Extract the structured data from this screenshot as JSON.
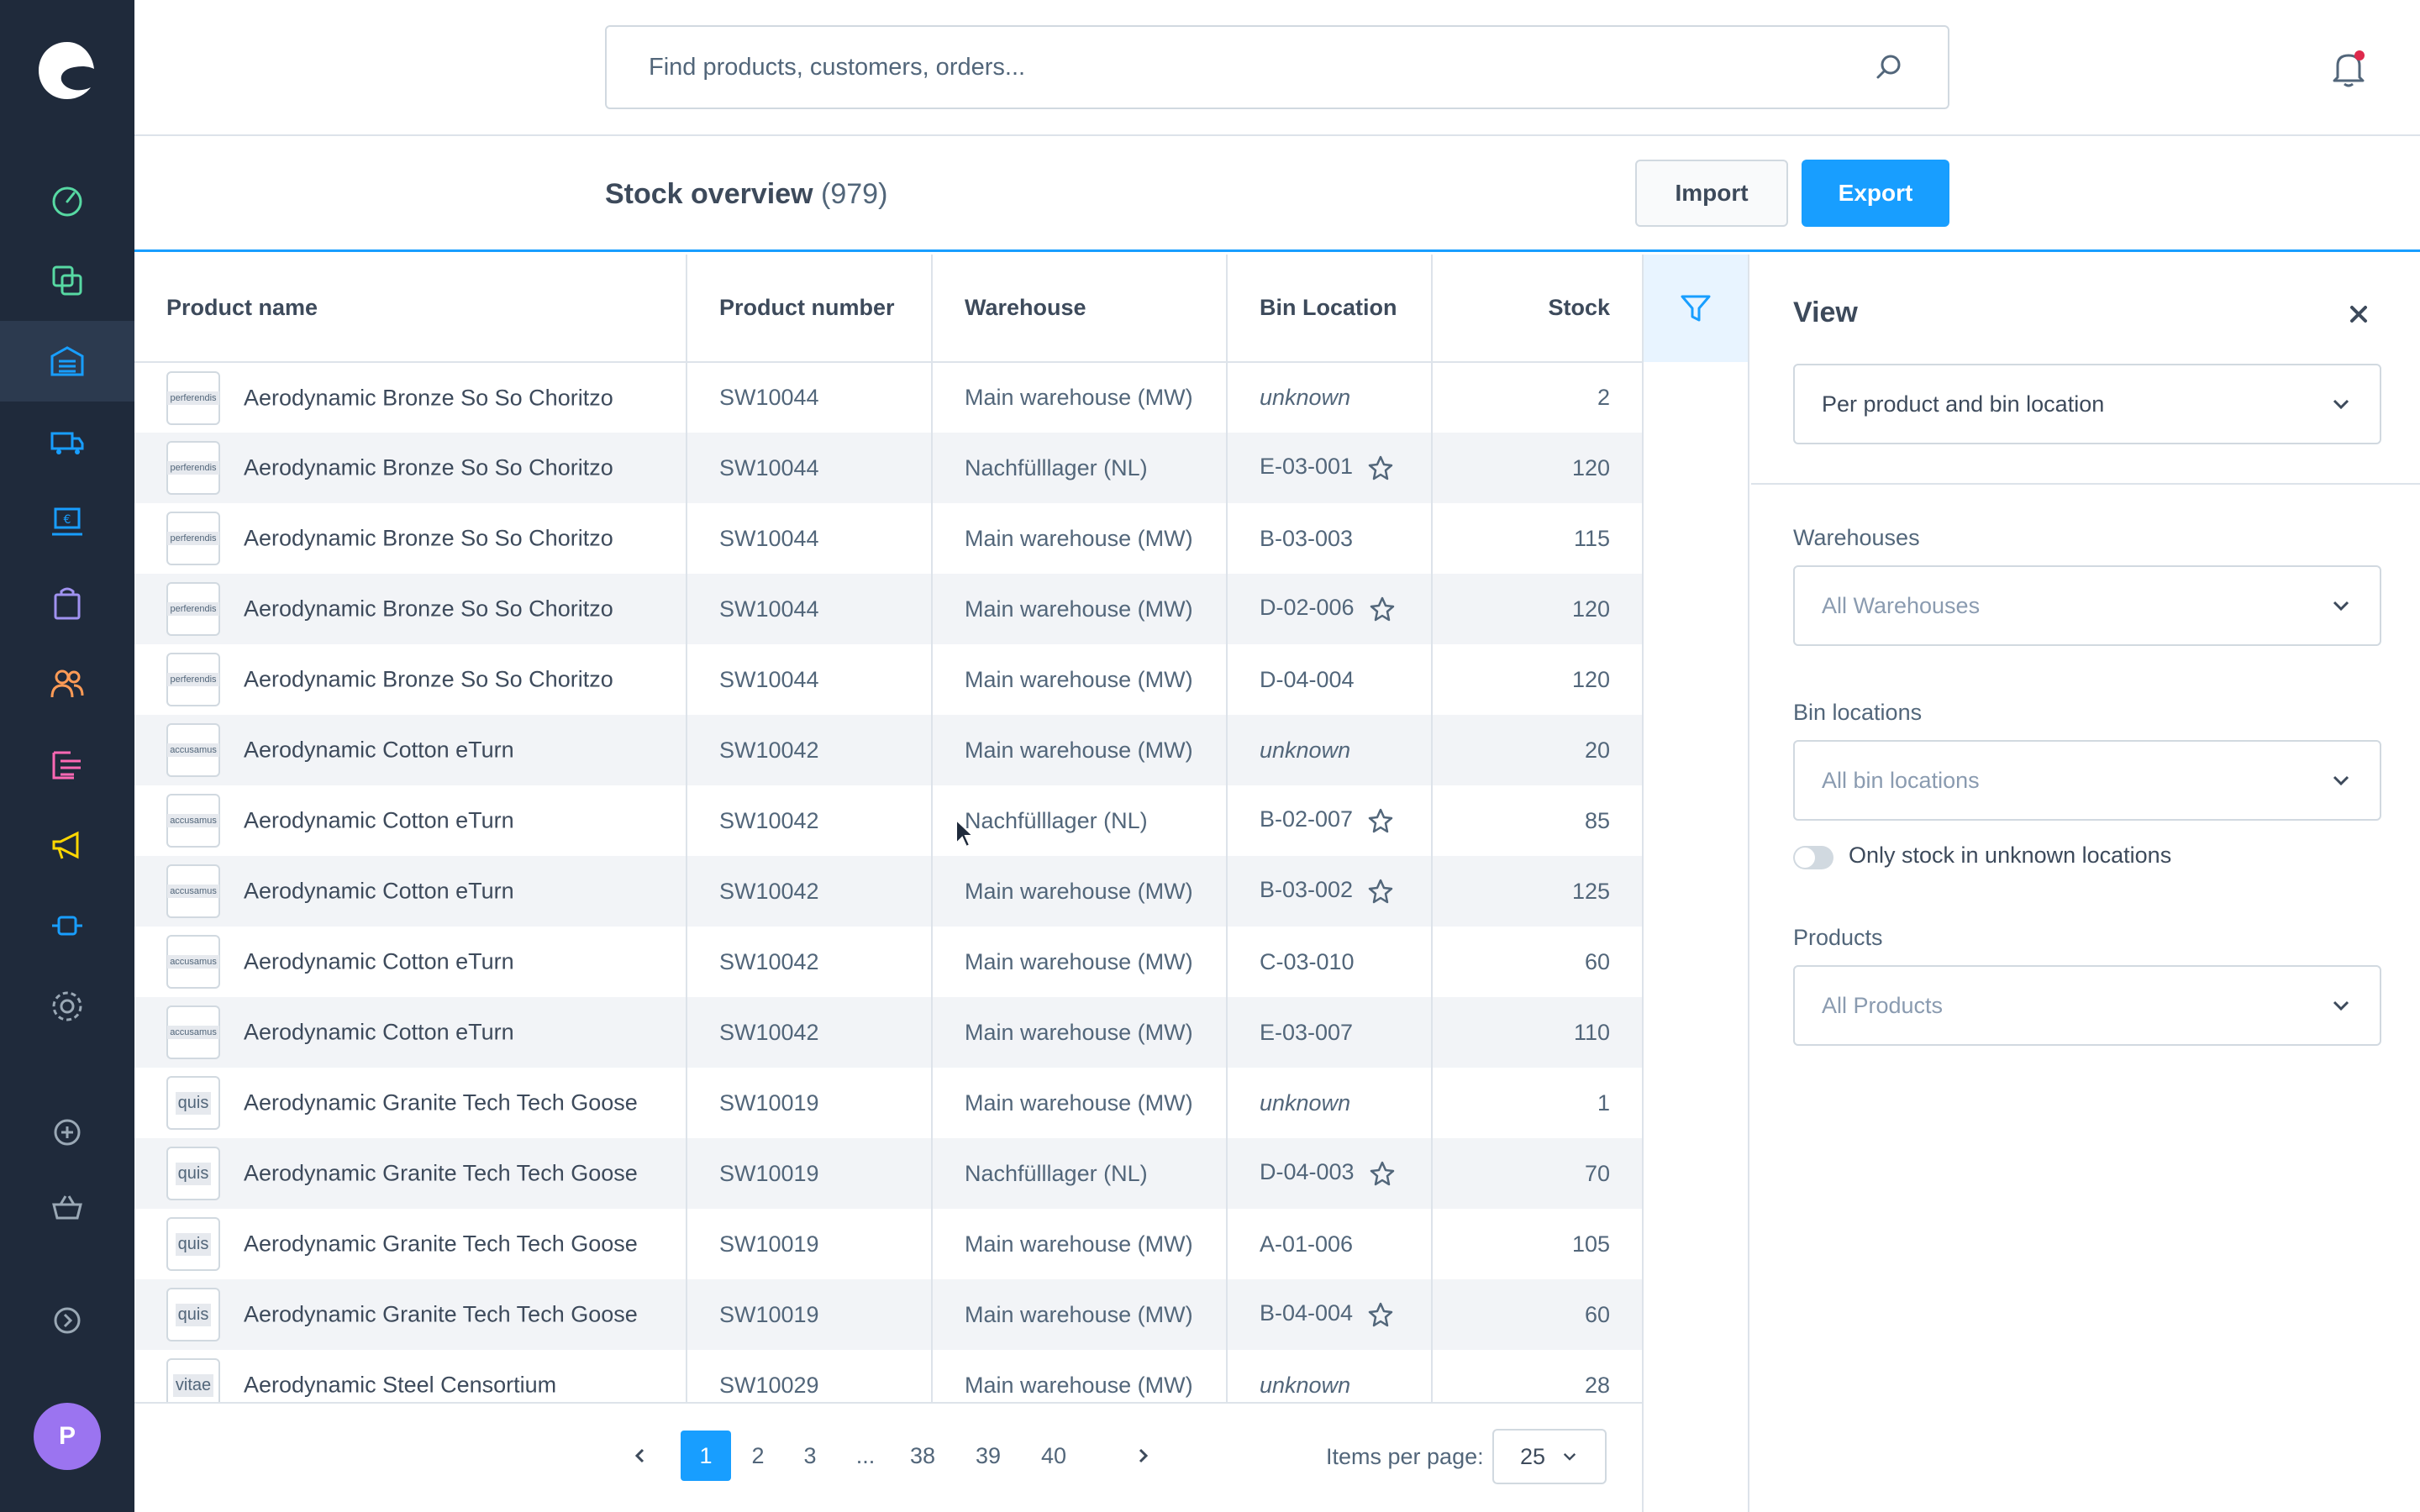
{
  "sidebar": {
    "items": [
      {
        "icon": "dashboard-icon",
        "color": "#57d9a3"
      },
      {
        "icon": "catalog-icon",
        "color": "#57d9a3"
      },
      {
        "icon": "warehouse-icon",
        "color": "#189eff"
      },
      {
        "icon": "shipping-icon",
        "color": "#189eff"
      },
      {
        "icon": "pos-icon",
        "color": "#189eff"
      },
      {
        "icon": "orders-icon",
        "color": "#a092f0"
      },
      {
        "icon": "customers-icon",
        "color": "#ff9b56"
      },
      {
        "icon": "content-icon",
        "color": "#ff68b4"
      },
      {
        "icon": "marketing-icon",
        "color": "#ffd700"
      },
      {
        "icon": "extensions-icon",
        "color": "#189eff"
      },
      {
        "icon": "settings-icon",
        "color": "#9aa8b5"
      },
      {
        "icon": "add-icon",
        "color": "#9aa8b5"
      },
      {
        "icon": "basket-icon",
        "color": "#9aa8b5"
      },
      {
        "icon": "expand-icon",
        "color": "#9aa8b5"
      }
    ],
    "avatar_initial": "P"
  },
  "search": {
    "placeholder": "Find products, customers, orders..."
  },
  "header": {
    "title": "Stock overview",
    "count": "(979)",
    "import_label": "Import",
    "export_label": "Export"
  },
  "table": {
    "columns": [
      "Product name",
      "Product number",
      "Warehouse",
      "Bin Location",
      "Stock"
    ],
    "rows": [
      {
        "thumb": "perferendis",
        "name": "Aerodynamic Bronze So So Choritzo",
        "number": "SW10044",
        "warehouse": "Main warehouse (MW)",
        "bin": "unknown",
        "unknown": true,
        "star": false,
        "stock": "2"
      },
      {
        "thumb": "perferendis",
        "name": "Aerodynamic Bronze So So Choritzo",
        "number": "SW10044",
        "warehouse": "Nachfülllager (NL)",
        "bin": "E-03-001",
        "unknown": false,
        "star": true,
        "stock": "120"
      },
      {
        "thumb": "perferendis",
        "name": "Aerodynamic Bronze So So Choritzo",
        "number": "SW10044",
        "warehouse": "Main warehouse (MW)",
        "bin": "B-03-003",
        "unknown": false,
        "star": false,
        "stock": "115"
      },
      {
        "thumb": "perferendis",
        "name": "Aerodynamic Bronze So So Choritzo",
        "number": "SW10044",
        "warehouse": "Main warehouse (MW)",
        "bin": "D-02-006",
        "unknown": false,
        "star": true,
        "stock": "120"
      },
      {
        "thumb": "perferendis",
        "name": "Aerodynamic Bronze So So Choritzo",
        "number": "SW10044",
        "warehouse": "Main warehouse (MW)",
        "bin": "D-04-004",
        "unknown": false,
        "star": false,
        "stock": "120"
      },
      {
        "thumb": "accusamus",
        "name": "Aerodynamic Cotton eTurn",
        "number": "SW10042",
        "warehouse": "Main warehouse (MW)",
        "bin": "unknown",
        "unknown": true,
        "star": false,
        "stock": "20"
      },
      {
        "thumb": "accusamus",
        "name": "Aerodynamic Cotton eTurn",
        "number": "SW10042",
        "warehouse": "Nachfülllager (NL)",
        "bin": "B-02-007",
        "unknown": false,
        "star": true,
        "stock": "85"
      },
      {
        "thumb": "accusamus",
        "name": "Aerodynamic Cotton eTurn",
        "number": "SW10042",
        "warehouse": "Main warehouse (MW)",
        "bin": "B-03-002",
        "unknown": false,
        "star": true,
        "stock": "125"
      },
      {
        "thumb": "accusamus",
        "name": "Aerodynamic Cotton eTurn",
        "number": "SW10042",
        "warehouse": "Main warehouse (MW)",
        "bin": "C-03-010",
        "unknown": false,
        "star": false,
        "stock": "60"
      },
      {
        "thumb": "accusamus",
        "name": "Aerodynamic Cotton eTurn",
        "number": "SW10042",
        "warehouse": "Main warehouse (MW)",
        "bin": "E-03-007",
        "unknown": false,
        "star": false,
        "stock": "110"
      },
      {
        "thumb": "quis",
        "name": "Aerodynamic Granite Tech Tech Goose",
        "number": "SW10019",
        "warehouse": "Main warehouse (MW)",
        "bin": "unknown",
        "unknown": true,
        "star": false,
        "stock": "1"
      },
      {
        "thumb": "quis",
        "name": "Aerodynamic Granite Tech Tech Goose",
        "number": "SW10019",
        "warehouse": "Nachfülllager (NL)",
        "bin": "D-04-003",
        "unknown": false,
        "star": true,
        "stock": "70"
      },
      {
        "thumb": "quis",
        "name": "Aerodynamic Granite Tech Tech Goose",
        "number": "SW10019",
        "warehouse": "Main warehouse (MW)",
        "bin": "A-01-006",
        "unknown": false,
        "star": false,
        "stock": "105"
      },
      {
        "thumb": "quis",
        "name": "Aerodynamic Granite Tech Tech Goose",
        "number": "SW10019",
        "warehouse": "Main warehouse (MW)",
        "bin": "B-04-004",
        "unknown": false,
        "star": true,
        "stock": "60"
      },
      {
        "thumb": "vitae",
        "name": "Aerodynamic Steel Censortium",
        "number": "SW10029",
        "warehouse": "Main warehouse (MW)",
        "bin": "unknown",
        "unknown": true,
        "star": false,
        "stock": "28"
      }
    ]
  },
  "panel": {
    "title": "View",
    "view_value": "Per product and bin location",
    "warehouses_label": "Warehouses",
    "warehouses_placeholder": "All Warehouses",
    "bins_label": "Bin locations",
    "bins_placeholder": "All bin locations",
    "toggle_label": "Only stock in unknown locations",
    "toggle_on": false,
    "products_label": "Products",
    "products_placeholder": "All Products"
  },
  "pagination": {
    "pages": [
      "1",
      "2",
      "3",
      "...",
      "38",
      "39",
      "40"
    ],
    "current": "1",
    "items_per_page_label": "Items per page:",
    "items_per_page": "25"
  },
  "colors": {
    "accent": "#189eff",
    "sidebar": "#1f2a3b"
  }
}
